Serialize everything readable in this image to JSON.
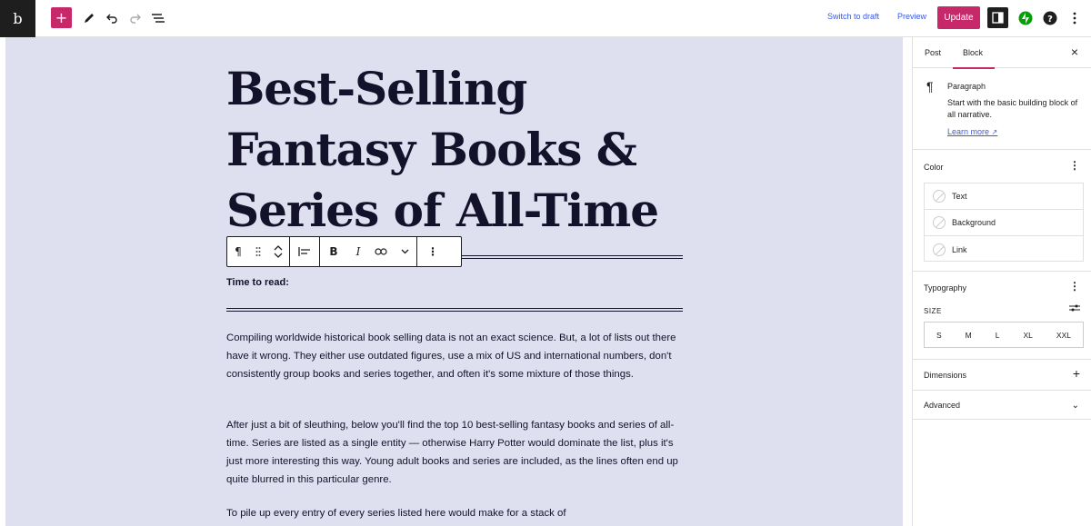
{
  "topbar": {
    "site_logo": "b",
    "inserter": "+",
    "switch_to_draft": "Switch to draft",
    "preview": "Preview",
    "update": "Update",
    "icons": [
      "site-icon",
      "add-block-icon",
      "edit-tools-icon",
      "undo-icon",
      "redo-icon",
      "list-view-icon",
      "settings-icon",
      "plugin-icon",
      "help-icon",
      "options-icon"
    ]
  },
  "post": {
    "title": "Best-Selling Fantasy Books & Series of All-Time",
    "time_to_read": "Time to read:",
    "paragraphs": [
      "Compiling worldwide historical book selling data is not an exact science. But, a lot of lists out there have it wrong. They either use outdated figures, use a mix of US and international numbers, don't consistently group books and series together, and often it's some mixture of those things.",
      "After just a bit of sleuthing, below you'll find the top 10 best-selling fantasy books and series of all-time. Series are listed as a single entity — otherwise Harry Potter would dominate the list, plus it's just more interesting this way. Young adult books and series are included, as the lines often end up quite blurred in this particular genre.",
      "To pile up every entry of every series listed here would make for a stack of"
    ]
  },
  "block_toolbar": {
    "paragraph": "¶",
    "bold": "B",
    "italic": "I",
    "more": "⋮"
  },
  "sidebar": {
    "tabs": [
      "Post",
      "Block"
    ],
    "active_tab": "Block",
    "close": "×",
    "block": {
      "icon": "¶",
      "title": "Paragraph",
      "description": "Start with the basic building block of all narrative.",
      "learn_more": "Learn more"
    },
    "color": {
      "heading": "Color",
      "items": [
        "Text",
        "Background",
        "Link"
      ]
    },
    "typography": {
      "heading": "Typography",
      "size_label": "SIZE",
      "sizes": [
        "S",
        "M",
        "L",
        "XL",
        "XXL"
      ]
    },
    "dimensions": "Dimensions",
    "advanced": "Advanced"
  },
  "colors": {
    "accent": "#c7286a",
    "link": "#3858e9",
    "canvas_bg": "#dfe0ef",
    "text": "#14112b"
  }
}
